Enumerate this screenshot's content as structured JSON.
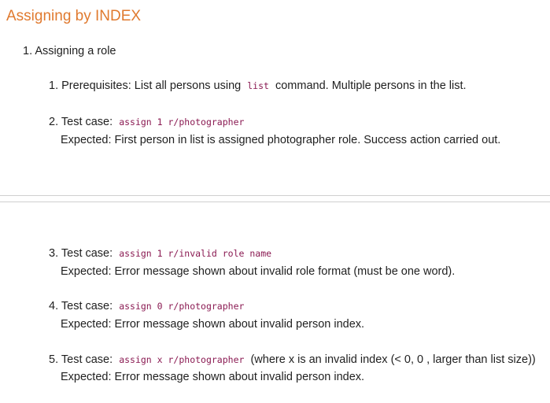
{
  "heading": "Assigning by INDEX",
  "outer_item": {
    "number": "1.",
    "label": "Assigning a role"
  },
  "steps": [
    {
      "number": "1.",
      "pre": "Prerequisites: List all persons using",
      "code": "list",
      "post": "command. Multiple persons in the list."
    },
    {
      "number": "2.",
      "pre": "Test case:",
      "code": "assign 1 r/photographer",
      "expected": "Expected: First person in list is assigned photographer role. Success action carried out."
    },
    {
      "number": "3.",
      "pre": "Test case:",
      "code": "assign 1 r/invalid role name",
      "expected": "Expected: Error message shown about invalid role format (must be one word)."
    },
    {
      "number": "4.",
      "pre": "Test case:",
      "code": "assign 0 r/photographer",
      "expected": "Expected: Error message shown about invalid person index."
    },
    {
      "number": "5.",
      "pre": "Test case:",
      "code": "assign x r/photographer",
      "post": "(where x is an invalid index (< 0, 0 , larger than list size))",
      "expected": "Expected: Error message shown about invalid person index."
    }
  ]
}
